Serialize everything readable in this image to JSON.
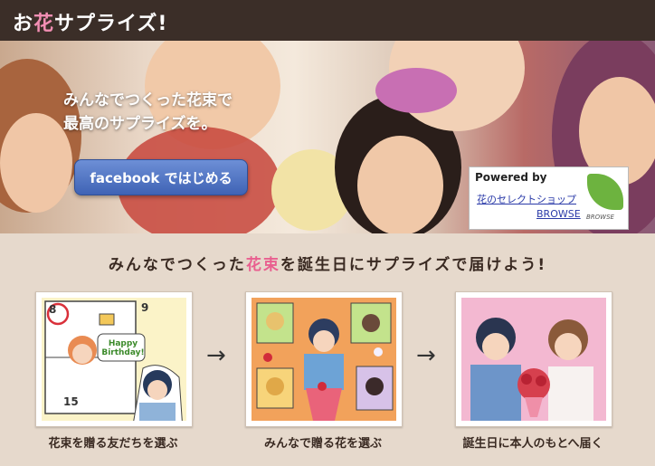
{
  "header": {
    "logo_prefix": "お",
    "logo_accent": "花",
    "logo_suffix": "サプライズ!"
  },
  "hero": {
    "line1": "みんなでつくった花束で",
    "line2": "最高のサプライズを。",
    "cta_label": "facebook ではじめる",
    "powered": {
      "title": "Powered by",
      "link1": "花のセレクトショップ",
      "link2": "BROWSE",
      "logo_text": "BROWSE"
    }
  },
  "tagline": {
    "pre": "みんなでつくった",
    "highlight": "花束",
    "post": "を誕生日にサプライズで届けよう!"
  },
  "steps": [
    {
      "caption": "花束を贈る友だちを選ぶ",
      "date_circle": "8",
      "num_nine": "9",
      "num_fifteen": "15",
      "bubble_line1": "Happy",
      "bubble_line2": "Birthday!"
    },
    {
      "caption": "みんなで贈る花を選ぶ"
    },
    {
      "caption": "誕生日に本人のもとへ届く"
    }
  ],
  "arrows": [
    "→",
    "→"
  ]
}
